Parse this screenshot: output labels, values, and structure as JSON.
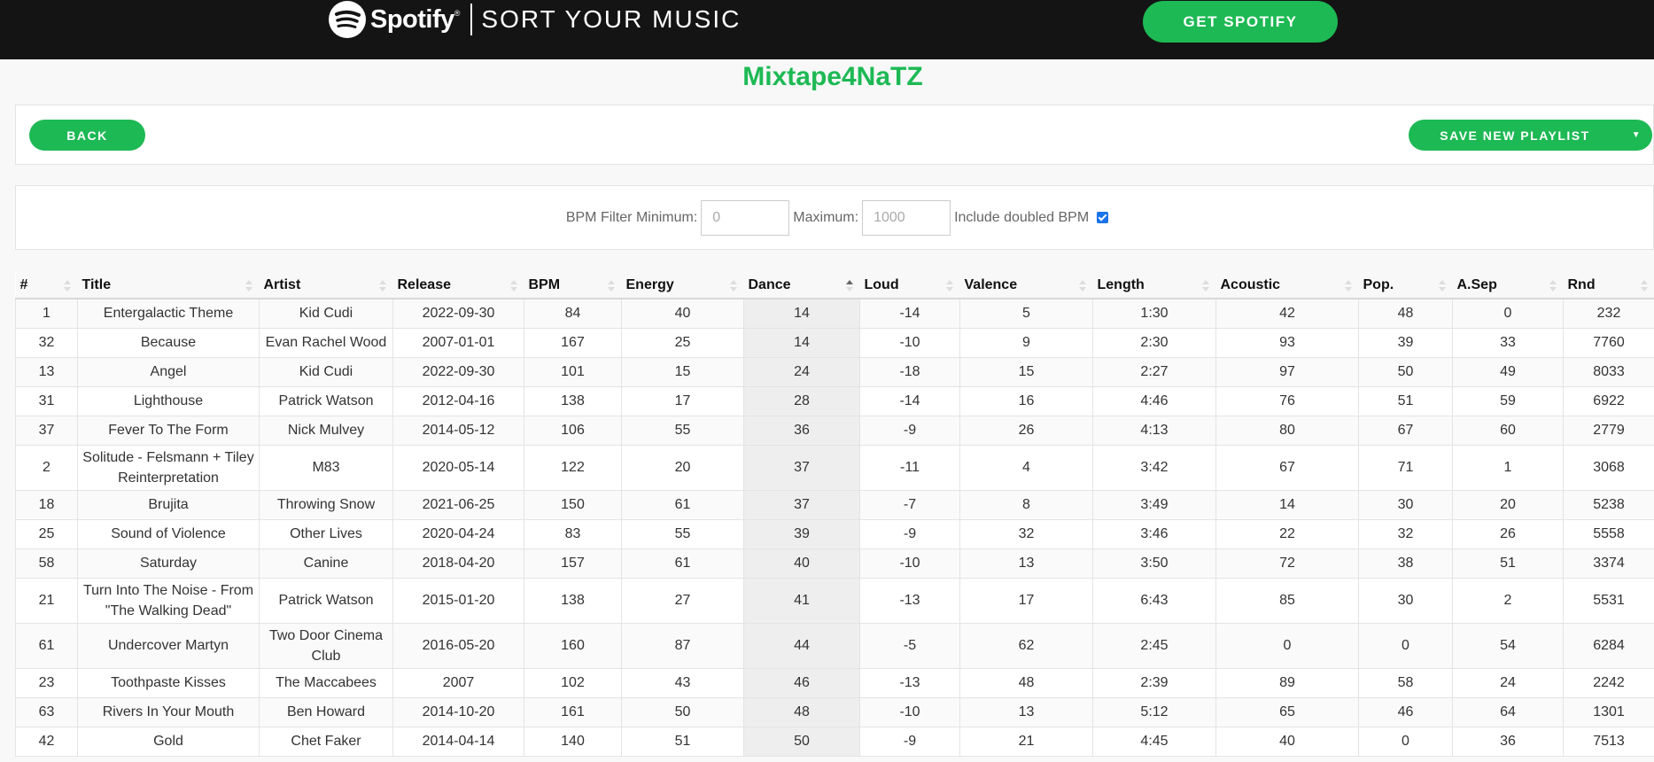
{
  "header": {
    "brand": "Spotify",
    "trademark": "®",
    "app_name": "SORT YOUR MUSIC",
    "cta_label": "GET SPOTIFY",
    "logo_icon": "spotify-logo-icon",
    "accent_color": "#1db954"
  },
  "playlist": {
    "title": "Mixtape4NaTZ"
  },
  "actions": {
    "back_label": "BACK",
    "save_label": "SAVE NEW PLAYLIST",
    "save_menu_icon": "caret-down-icon"
  },
  "filter": {
    "min_label": "BPM Filter Minimum:",
    "min_placeholder": "0",
    "max_label": "Maximum:",
    "max_placeholder": "1000",
    "doubled_label": "Include doubled BPM",
    "doubled_checked": true
  },
  "table": {
    "sorted_column": "Dance",
    "sort_direction": "ascending",
    "columns": [
      "#",
      "Title",
      "Artist",
      "Release",
      "BPM",
      "Energy",
      "Dance",
      "Loud",
      "Valence",
      "Length",
      "Acoustic",
      "Pop.",
      "A.Sep",
      "Rnd"
    ],
    "rows": [
      [
        "1",
        "Entergalactic Theme",
        "Kid Cudi",
        "2022-09-30",
        "84",
        "40",
        "14",
        "-14",
        "5",
        "1:30",
        "42",
        "48",
        "0",
        "232"
      ],
      [
        "32",
        "Because",
        "Evan Rachel Wood",
        "2007-01-01",
        "167",
        "25",
        "14",
        "-10",
        "9",
        "2:30",
        "93",
        "39",
        "33",
        "7760"
      ],
      [
        "13",
        "Angel",
        "Kid Cudi",
        "2022-09-30",
        "101",
        "15",
        "24",
        "-18",
        "15",
        "2:27",
        "97",
        "50",
        "49",
        "8033"
      ],
      [
        "31",
        "Lighthouse",
        "Patrick Watson",
        "2012-04-16",
        "138",
        "17",
        "28",
        "-14",
        "16",
        "4:46",
        "76",
        "51",
        "59",
        "6922"
      ],
      [
        "37",
        "Fever To The Form",
        "Nick Mulvey",
        "2014-05-12",
        "106",
        "55",
        "36",
        "-9",
        "26",
        "4:13",
        "80",
        "67",
        "60",
        "2779"
      ],
      [
        "2",
        "Solitude - Felsmann + Tiley Reinterpretation",
        "M83",
        "2020-05-14",
        "122",
        "20",
        "37",
        "-11",
        "4",
        "3:42",
        "67",
        "71",
        "1",
        "3068"
      ],
      [
        "18",
        "Brujita",
        "Throwing Snow",
        "2021-06-25",
        "150",
        "61",
        "37",
        "-7",
        "8",
        "3:49",
        "14",
        "30",
        "20",
        "5238"
      ],
      [
        "25",
        "Sound of Violence",
        "Other Lives",
        "2020-04-24",
        "83",
        "55",
        "39",
        "-9",
        "32",
        "3:46",
        "22",
        "32",
        "26",
        "5558"
      ],
      [
        "58",
        "Saturday",
        "Canine",
        "2018-04-20",
        "157",
        "61",
        "40",
        "-10",
        "13",
        "3:50",
        "72",
        "38",
        "51",
        "3374"
      ],
      [
        "21",
        "Turn Into The Noise - From \"The Walking Dead\"",
        "Patrick Watson",
        "2015-01-20",
        "138",
        "27",
        "41",
        "-13",
        "17",
        "6:43",
        "85",
        "30",
        "2",
        "5531"
      ],
      [
        "61",
        "Undercover Martyn",
        "Two Door Cinema Club",
        "2016-05-20",
        "160",
        "87",
        "44",
        "-5",
        "62",
        "2:45",
        "0",
        "0",
        "54",
        "6284"
      ],
      [
        "23",
        "Toothpaste Kisses",
        "The Maccabees",
        "2007",
        "102",
        "43",
        "46",
        "-13",
        "48",
        "2:39",
        "89",
        "58",
        "24",
        "2242"
      ],
      [
        "63",
        "Rivers In Your Mouth",
        "Ben Howard",
        "2014-10-20",
        "161",
        "50",
        "48",
        "-10",
        "13",
        "5:12",
        "65",
        "46",
        "64",
        "1301"
      ],
      [
        "42",
        "Gold",
        "Chet Faker",
        "2014-04-14",
        "140",
        "51",
        "50",
        "-9",
        "21",
        "4:45",
        "40",
        "0",
        "36",
        "7513"
      ]
    ]
  }
}
